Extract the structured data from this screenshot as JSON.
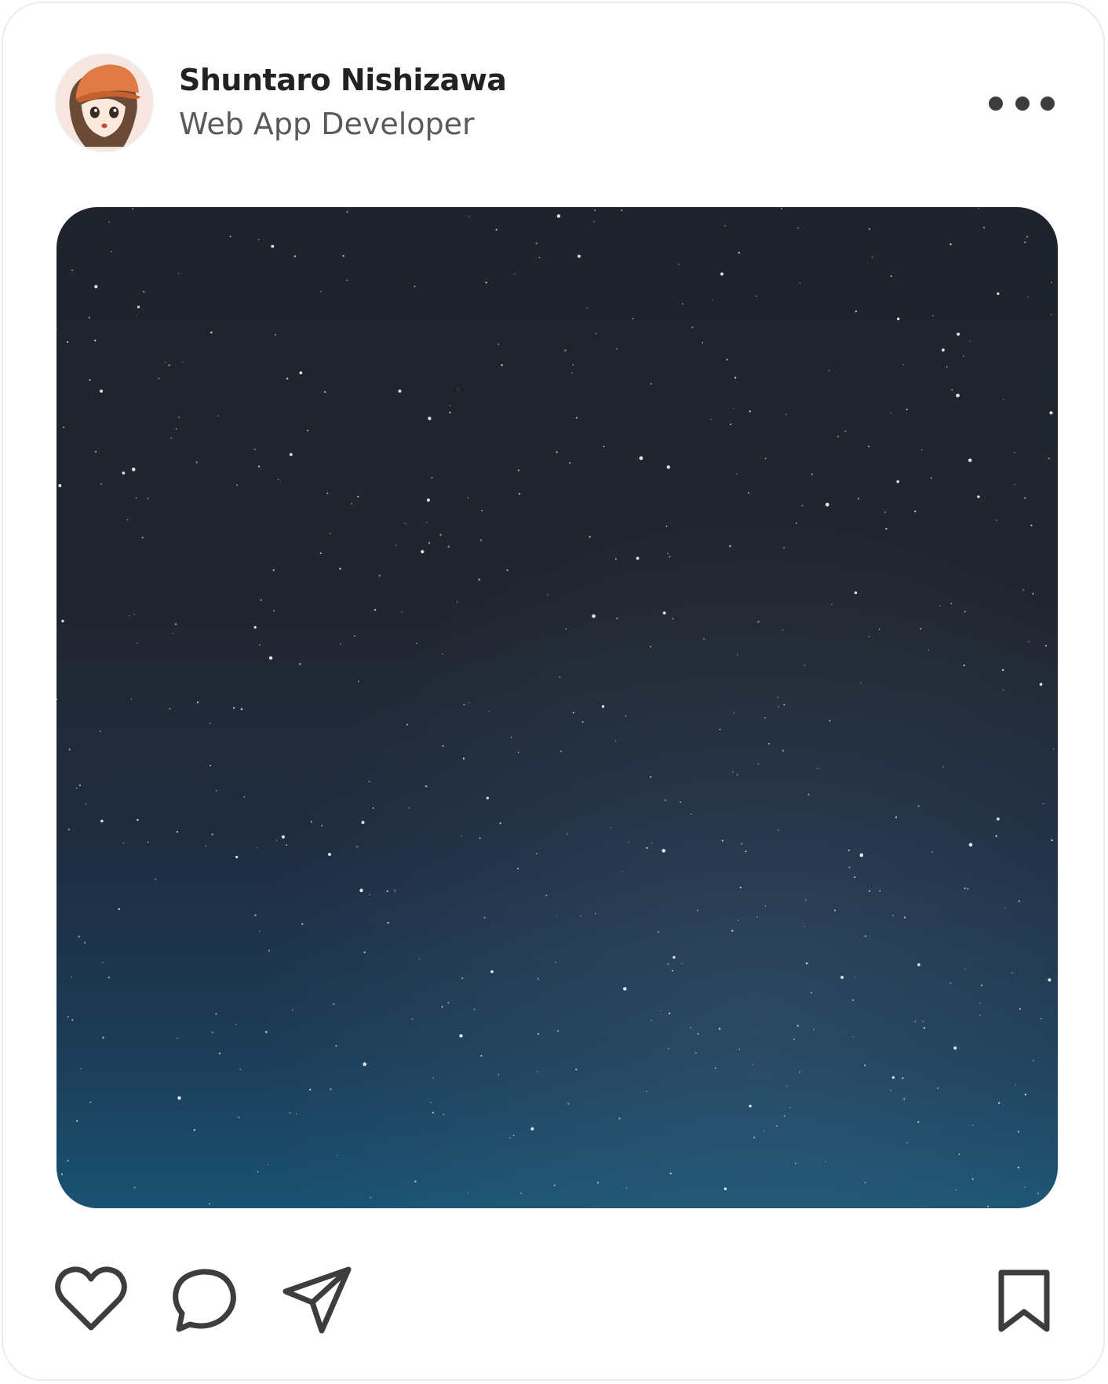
{
  "post": {
    "author": {
      "name": "Shuntaro Nishizawa",
      "role": "Web App Developer",
      "avatar_icon": "avatar-icon"
    },
    "menu_icon": "more-horizontal-icon",
    "image": {
      "description_icon": "starry-night-sky-image"
    },
    "actions": {
      "like_icon": "heart-icon",
      "comment_icon": "comment-bubble-icon",
      "share_icon": "send-paper-plane-icon",
      "save_icon": "bookmark-icon"
    }
  },
  "colors": {
    "name_text": "#222222",
    "role_text": "#5a5a5a",
    "icon_stroke": "#3d3d3d",
    "sky_top": "#1f232b",
    "sky_bottom": "#1a5272",
    "card_border": "#ececec"
  }
}
